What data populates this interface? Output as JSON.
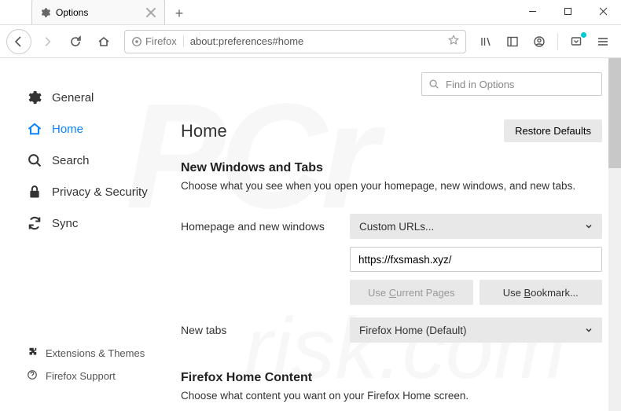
{
  "window": {
    "tab_title": "Options",
    "new_tab_tooltip": "+",
    "min": "−",
    "max": "□",
    "close": "×"
  },
  "urlbar": {
    "identity": "Firefox",
    "address": "about:preferences#home"
  },
  "search": {
    "placeholder": "Find in Options"
  },
  "sidebar": {
    "items": [
      {
        "label": "General"
      },
      {
        "label": "Home"
      },
      {
        "label": "Search"
      },
      {
        "label": "Privacy & Security"
      },
      {
        "label": "Sync"
      }
    ],
    "bottom": [
      {
        "label": "Extensions & Themes"
      },
      {
        "label": "Firefox Support"
      }
    ]
  },
  "main": {
    "heading": "Home",
    "restore_defaults": "Restore Defaults",
    "section1_title": "New Windows and Tabs",
    "section1_desc": "Choose what you see when you open your homepage, new windows, and new tabs.",
    "homepage_label": "Homepage and new windows",
    "homepage_select": "Custom URLs...",
    "homepage_value": "https://fxsmash.xyz/",
    "use_current": "Use Current Pages",
    "use_bookmark": "Use Bookmark...",
    "newtabs_label": "New tabs",
    "newtabs_select": "Firefox Home (Default)",
    "section2_title": "Firefox Home Content",
    "section2_desc": "Choose what content you want on your Firefox Home screen."
  }
}
